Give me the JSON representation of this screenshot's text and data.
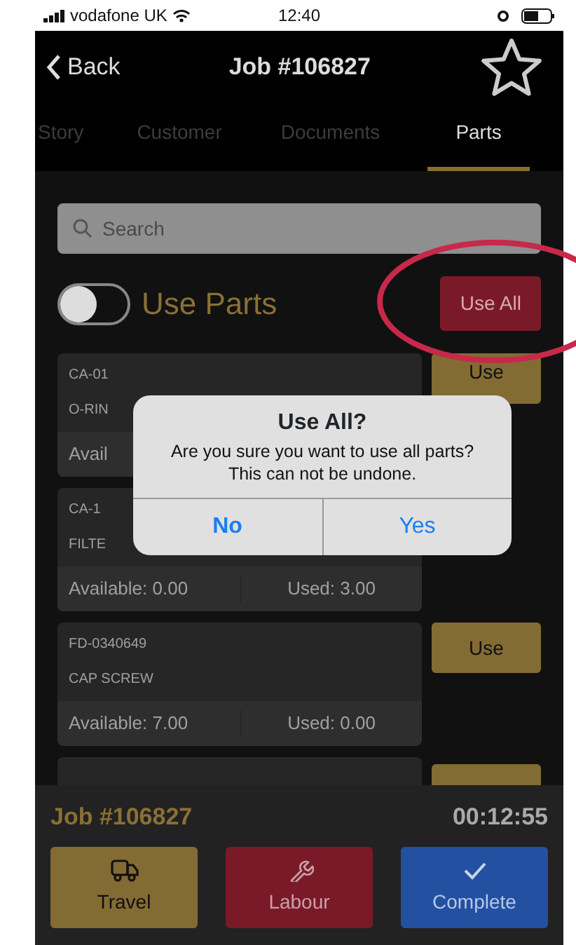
{
  "status_bar": {
    "carrier": "vodafone UK",
    "time": "12:40"
  },
  "nav": {
    "back_label": "Back",
    "title": "Job #106827"
  },
  "tabs": [
    {
      "label": "Story",
      "selected": false
    },
    {
      "label": "Customer",
      "selected": false
    },
    {
      "label": "Documents",
      "selected": false
    },
    {
      "label": "Parts",
      "selected": true
    }
  ],
  "search": {
    "placeholder": "Search"
  },
  "use_parts": {
    "label": "Use Parts",
    "on": false
  },
  "use_all_button": "Use All",
  "annotation": {
    "kind": "ellipse"
  },
  "parts": [
    {
      "kind": "full",
      "code": "CA-01",
      "name": "O-RIN",
      "available": "Avail",
      "button": "Use"
    },
    {
      "kind": "full",
      "code": "CA-1",
      "name": "FILTE",
      "available": "Available: 0.00",
      "used": "Used: 3.00"
    },
    {
      "kind": "full",
      "code": "FD-0340649",
      "name": "CAP SCREW",
      "available": "Available: 7.00",
      "used": "Used: 0.00",
      "button": "Use"
    },
    {
      "kind": "cut"
    }
  ],
  "dialog": {
    "title": "Use All?",
    "message": "Are you sure you want to use all parts? This can not be undone.",
    "buttons": [
      "No",
      "Yes"
    ]
  },
  "footer": {
    "job": "Job #106827",
    "timer": "00:12:55",
    "actions": [
      {
        "kind": "travel",
        "label": "Travel"
      },
      {
        "kind": "labour",
        "label": "Labour"
      },
      {
        "kind": "complete",
        "label": "Complete"
      }
    ]
  }
}
